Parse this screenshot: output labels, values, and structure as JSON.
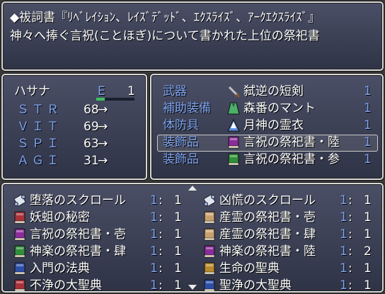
{
  "help": {
    "line1": "◆祓詞書『ﾘﾍﾞﾚｲｼｮﾝ、ﾚｲｽﾞﾃﾞｯﾄﾞ、ｴｸｽﾗｲｽﾞ、ｱｰｸｴｸｽﾗｲｽﾞ』",
    "line2": "神々へ捧ぐ言祝(ことほぎ)について書かれた上位の祭祀書"
  },
  "status": {
    "name": "ハサナ",
    "equip_mark": "E",
    "equip_count": "1",
    "stats": [
      {
        "label": "ＳＴＲ",
        "value": "68",
        "arrow": "→"
      },
      {
        "label": "ＶＩＴ",
        "value": "69",
        "arrow": "→"
      },
      {
        "label": "ＳＰＩ",
        "value": "63",
        "arrow": "→"
      },
      {
        "label": "ＡＧＩ",
        "value": "31",
        "arrow": "→"
      }
    ]
  },
  "equipment": {
    "slots": [
      {
        "slot": "武器",
        "item": "弑逆の短剣",
        "count": "1",
        "icon": "dagger-icon",
        "color": "#c0c0c0"
      },
      {
        "slot": "補助装備",
        "item": "森番のマント",
        "count": "1",
        "icon": "cloak-icon",
        "color": "#4caf6a"
      },
      {
        "slot": "体防具",
        "item": "月神の霊衣",
        "count": "1",
        "icon": "robe-icon",
        "color": "#5b8de0"
      },
      {
        "slot": "装飾品",
        "item": "言祝の祭祀書・陸",
        "count": "1",
        "icon": "purple-book-icon",
        "color": "#8a2c9a"
      },
      {
        "slot": "装飾品",
        "item": "言祝の祭祀書・参",
        "count": "1",
        "icon": "green-book-icon",
        "color": "#2f8f3a"
      }
    ],
    "selected_index": 3
  },
  "inventory": {
    "items": [
      {
        "name": "堕落のスクロール",
        "c1": "1",
        "sep": ":",
        "c2": "1",
        "icon": "scroll-icon",
        "color": "#9db6d8"
      },
      {
        "name": "凶慌のスクロール",
        "c1": "1",
        "sep": ":",
        "c2": "1",
        "icon": "scroll-icon",
        "color": "#9db6d8"
      },
      {
        "name": "妖蛆の秘密",
        "c1": "1",
        "sep": ":",
        "c2": "1",
        "icon": "red-book-icon",
        "color": "#a8323a"
      },
      {
        "name": "産霊の祭祀書・壱",
        "c1": "1",
        "sep": ":",
        "c2": "1",
        "icon": "tan-book-icon",
        "color": "#c8a070"
      },
      {
        "name": "言祝の祭祀書・壱",
        "c1": "1",
        "sep": ":",
        "c2": "1",
        "icon": "purple-book-icon",
        "color": "#8a2c9a"
      },
      {
        "name": "産霊の祭祀書・肆",
        "c1": "1",
        "sep": ":",
        "c2": "1",
        "icon": "tan-book-icon",
        "color": "#c8a070"
      },
      {
        "name": "神楽の祭祀書・肆",
        "c1": "1",
        "sep": ":",
        "c2": "1",
        "icon": "green-book-icon",
        "color": "#2f8f3a"
      },
      {
        "name": "神楽の祭祀書・陸",
        "c1": "1",
        "sep": ":",
        "c2": "2",
        "icon": "purple-book-icon",
        "color": "#8a2c9a"
      },
      {
        "name": "入門の法典",
        "c1": "1",
        "sep": ":",
        "c2": "1",
        "icon": "blue-book-icon",
        "color": "#2d4fa8"
      },
      {
        "name": "生命の聖典",
        "c1": "1",
        "sep": ":",
        "c2": "1",
        "icon": "gold-book-icon",
        "color": "#b88a2a"
      },
      {
        "name": "不浄の大聖典",
        "c1": "1",
        "sep": ":",
        "c2": "1",
        "icon": "red-book-icon",
        "color": "#a8323a"
      },
      {
        "name": "聖浄の大聖典",
        "c1": "1",
        "sep": ":",
        "c2": "1",
        "icon": "blue-book-icon",
        "color": "#2d4fa8"
      }
    ]
  },
  "scroll": {
    "up": "▲",
    "down": "▼"
  }
}
